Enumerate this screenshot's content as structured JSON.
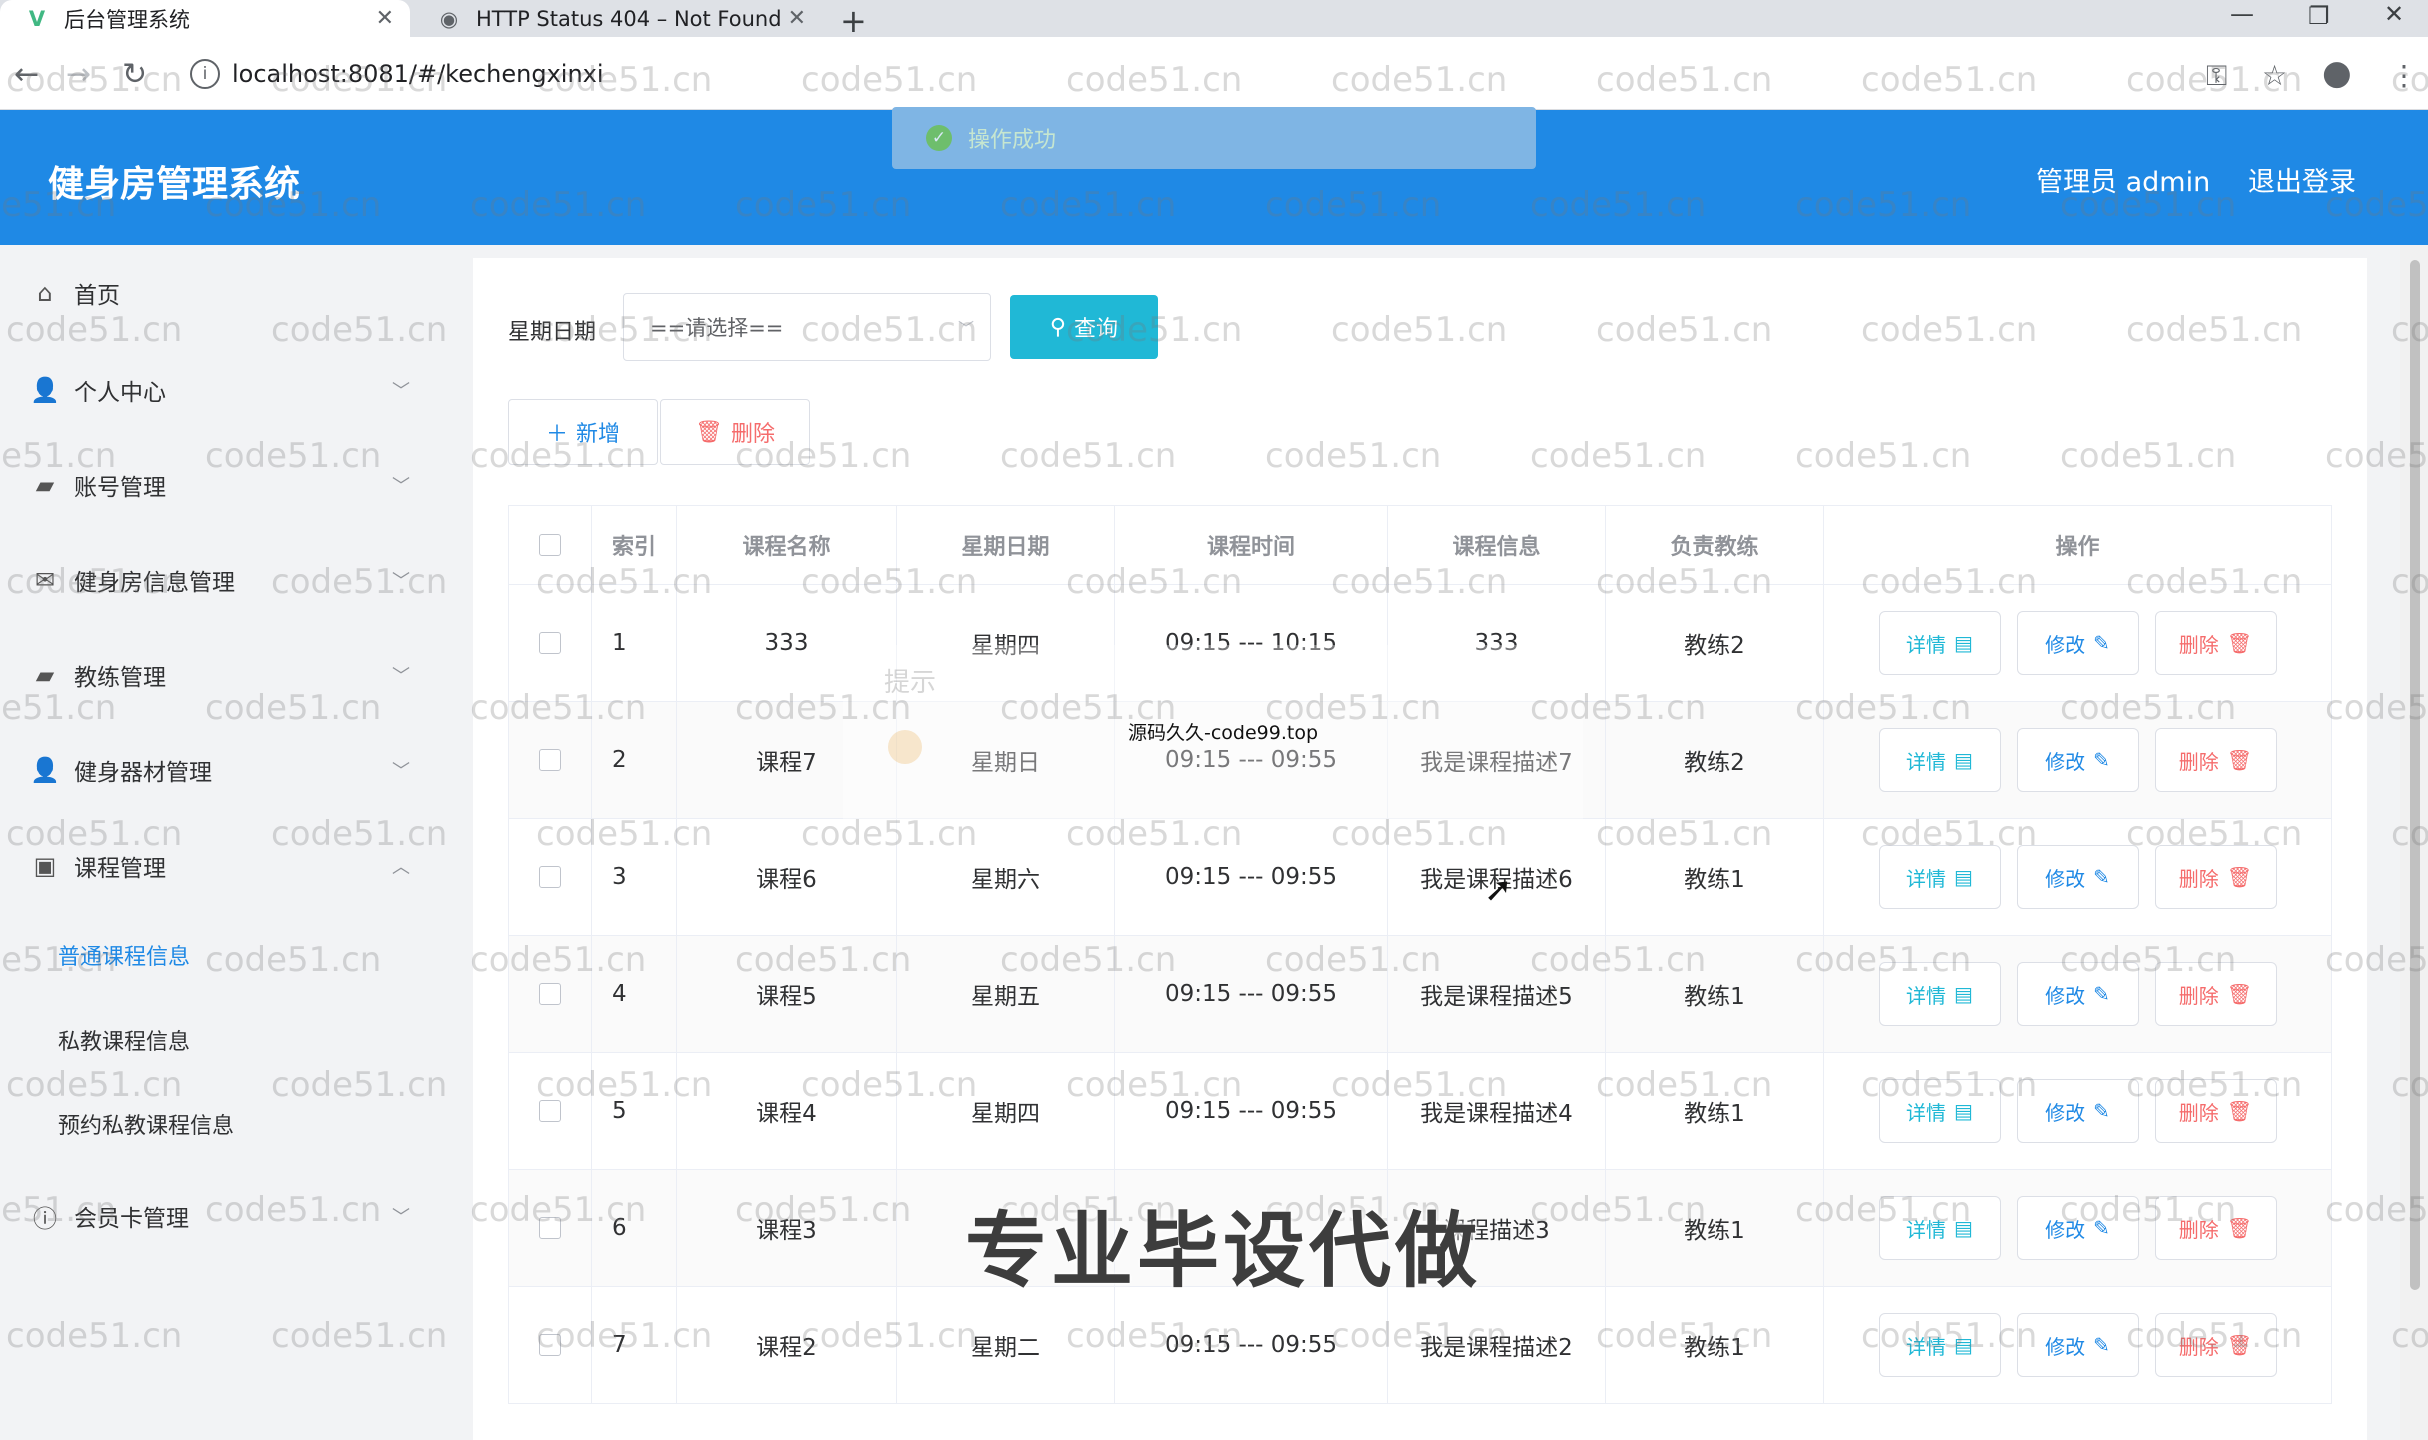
{
  "browser": {
    "tabs": [
      {
        "title": "后台管理系统",
        "favicon": "vue-logo-icon",
        "active": true
      },
      {
        "title": "HTTP Status 404 – Not Found",
        "favicon": "globe-icon",
        "active": false
      }
    ],
    "url": "localhost:8081/#/kechengxinxi"
  },
  "header": {
    "title": "健身房管理系统",
    "user": "管理员 admin",
    "logout": "退出登录",
    "bg_color": "#1f89e5"
  },
  "toast": {
    "message": "操作成功"
  },
  "sidebar": {
    "items": [
      {
        "label": "首页",
        "icon": "home-icon"
      },
      {
        "label": "个人中心",
        "icon": "user-icon"
      },
      {
        "label": "账号管理",
        "icon": "briefcase-icon"
      },
      {
        "label": "健身房信息管理",
        "icon": "mail-icon"
      },
      {
        "label": "教练管理",
        "icon": "briefcase-icon"
      },
      {
        "label": "健身器材管理",
        "icon": "user-icon"
      },
      {
        "label": "课程管理",
        "icon": "clipboard-icon"
      },
      {
        "label": "会员卡管理",
        "icon": "info-circle-icon"
      }
    ],
    "subitems": [
      "普通课程信息",
      "私教课程信息",
      "预约私教课程信息"
    ],
    "active_subitem": "普通课程信息"
  },
  "filter": {
    "label": "星期日期",
    "select_value": "==请选择==",
    "query_button": "查询"
  },
  "actions": {
    "add": "新增",
    "delete": "删除"
  },
  "table": {
    "headers": [
      "索引",
      "课程名称",
      "星期日期",
      "课程时间",
      "课程信息",
      "负责教练",
      "操作"
    ],
    "rows": [
      {
        "index": "1",
        "name": "333",
        "day": "星期四",
        "time": "09:15 --- 10:15",
        "info": "333",
        "coach": "教练2"
      },
      {
        "index": "2",
        "name": "课程7",
        "day": "星期日",
        "time": "09:15 --- 09:55",
        "info": "我是课程描述7",
        "coach": "教练2"
      },
      {
        "index": "3",
        "name": "课程6",
        "day": "星期六",
        "time": "09:15 --- 09:55",
        "info": "我是课程描述6",
        "coach": "教练1"
      },
      {
        "index": "4",
        "name": "课程5",
        "day": "星期五",
        "time": "09:15 --- 09:55",
        "info": "我是课程描述5",
        "coach": "教练1"
      },
      {
        "index": "5",
        "name": "课程4",
        "day": "星期四",
        "time": "09:15 --- 09:55",
        "info": "我是课程描述4",
        "coach": "教练1"
      },
      {
        "index": "6",
        "name": "课程3",
        "day": "",
        "time": "",
        "info": "课程描述3",
        "coach": "教练1"
      },
      {
        "index": "7",
        "name": "课程2",
        "day": "星期二",
        "time": "09:15 --- 09:55",
        "info": "我是课程描述2",
        "coach": "教练1"
      }
    ],
    "row_actions": {
      "detail": "详情",
      "edit": "修改",
      "delete": "删除"
    }
  },
  "overlays": {
    "watermark": "code51.cn",
    "dialog_title": "提示",
    "source_note": "源码久久-code99.top",
    "promo_text": "专业毕设代做"
  }
}
